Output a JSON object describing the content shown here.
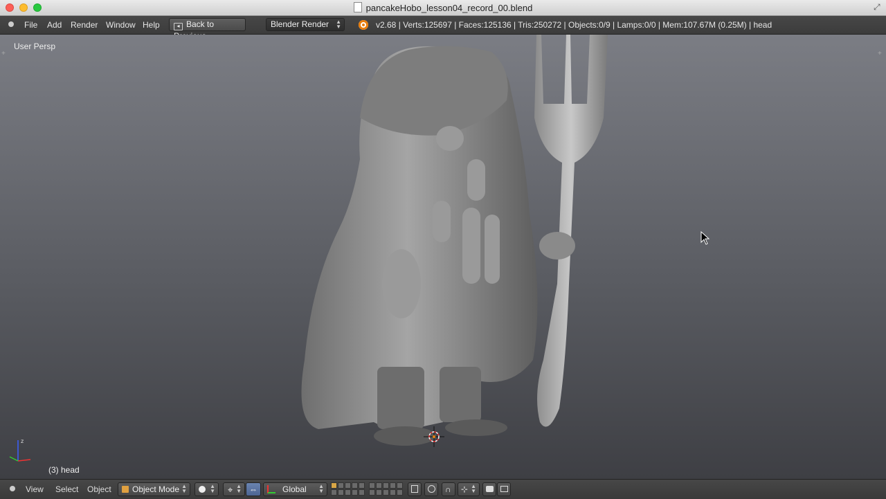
{
  "window": {
    "title": "pancakeHobo_lesson04_record_00.blend"
  },
  "info_header": {
    "menus": [
      "File",
      "Add",
      "Render",
      "Window",
      "Help"
    ],
    "back_button": "Back to Previous",
    "render_engine": "Blender Render",
    "stats": "v2.68 | Verts:125697 | Faces:125136 | Tris:250272 | Objects:0/9 | Lamps:0/0 | Mem:107.67M (0.25M) | head"
  },
  "viewport": {
    "view_name": "User Persp",
    "active_object": "(3) head",
    "model_color": "#8a8a8a"
  },
  "bottom_header": {
    "menus": [
      "View",
      "Select",
      "Object"
    ],
    "mode": "Object Mode",
    "orientation": "Global"
  },
  "colors": {
    "accent": "#e87d0d",
    "viewport_top": "#7b7d84",
    "viewport_bottom": "#3e3f44"
  }
}
